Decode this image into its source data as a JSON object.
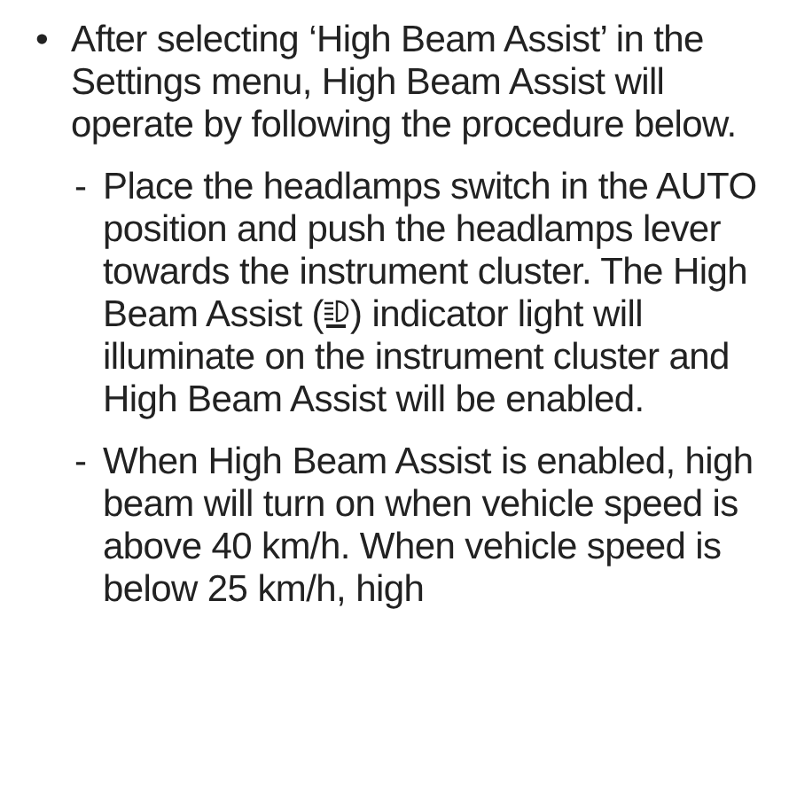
{
  "bullets": [
    {
      "marker": "•",
      "text": "After selecting ‘High Beam Assist’ in the Settings menu, High Beam Assist will operate by following the procedure below.",
      "steps": [
        {
          "marker": "-",
          "text_before_icon": "Place the headlamps switch in the AUTO position and push the headlamps lever towards the instrument cluster. The High Beam Assist (",
          "text_after_icon": ") indicator light will illuminate on the instrument cluster and High Beam Assist will be enabled."
        },
        {
          "marker": "-",
          "text": "When High Beam Assist is enabled, high beam will turn on when vehicle speed is above 40 km/h. When vehicle speed is below 25 km/h, high"
        }
      ]
    }
  ]
}
